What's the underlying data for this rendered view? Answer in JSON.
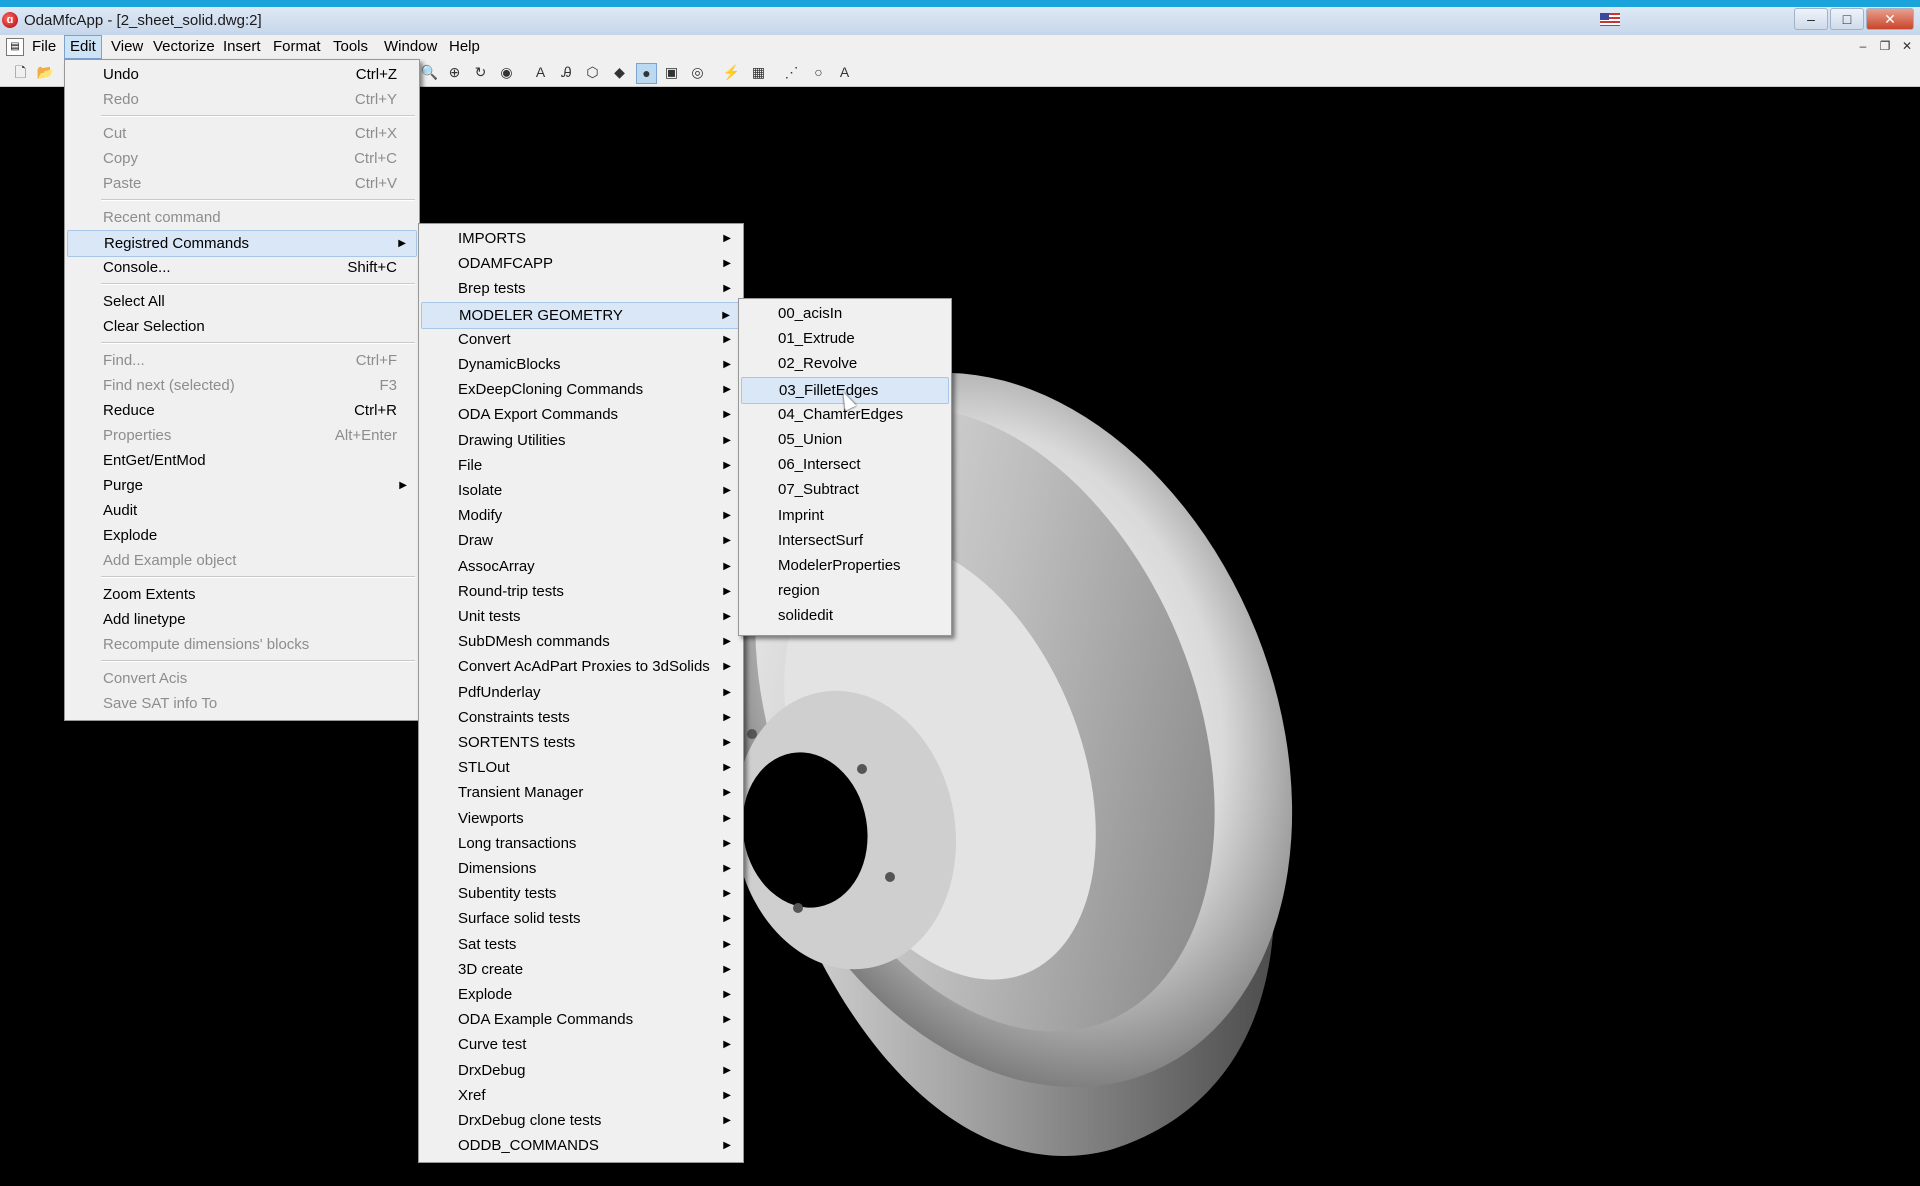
{
  "window": {
    "title": "OdaMfcApp - [2_sheet_solid.dwg:2]",
    "app_icon": "oda-app-icon",
    "controls": [
      "–",
      "□",
      "✕"
    ],
    "mdi_controls": [
      "–",
      "❐",
      "✕"
    ]
  },
  "menubar": [
    "File",
    "Edit",
    "View",
    "Vectorize",
    "Insert",
    "Format",
    "Tools",
    "Window",
    "Help"
  ],
  "edit_menu": [
    {
      "label": "Undo",
      "shortcut": "Ctrl+Z",
      "disabled": false
    },
    {
      "label": "Redo",
      "shortcut": "Ctrl+Y",
      "disabled": true
    },
    {
      "sep": true
    },
    {
      "label": "Cut",
      "shortcut": "Ctrl+X",
      "disabled": true
    },
    {
      "label": "Copy",
      "shortcut": "Ctrl+C",
      "disabled": true
    },
    {
      "label": "Paste",
      "shortcut": "Ctrl+V",
      "disabled": true
    },
    {
      "sep": true
    },
    {
      "label": "Recent command",
      "shortcut": "",
      "disabled": true
    },
    {
      "label": "Registred Commands",
      "shortcut": "",
      "submenu": true,
      "highlight": true
    },
    {
      "label": "Console...",
      "shortcut": "Shift+C",
      "disabled": false
    },
    {
      "sep": true
    },
    {
      "label": "Select All",
      "shortcut": "",
      "disabled": false
    },
    {
      "label": "Clear Selection",
      "shortcut": "",
      "disabled": false
    },
    {
      "sep": true
    },
    {
      "label": "Find...",
      "shortcut": "Ctrl+F",
      "disabled": true
    },
    {
      "label": "Find next (selected)",
      "shortcut": "F3",
      "disabled": true
    },
    {
      "label": "Reduce",
      "shortcut": "Ctrl+R",
      "disabled": false
    },
    {
      "label": "Properties",
      "shortcut": "Alt+Enter",
      "disabled": true
    },
    {
      "label": "EntGet/EntMod",
      "shortcut": "",
      "disabled": false
    },
    {
      "label": "Purge",
      "shortcut": "",
      "submenu": true
    },
    {
      "label": "Audit",
      "shortcut": "",
      "disabled": false
    },
    {
      "label": "Explode",
      "shortcut": "",
      "disabled": false
    },
    {
      "label": "Add Example object",
      "shortcut": "",
      "disabled": true
    },
    {
      "sep": true
    },
    {
      "label": "Zoom Extents",
      "shortcut": "",
      "disabled": false
    },
    {
      "label": "Add linetype",
      "shortcut": "",
      "disabled": false
    },
    {
      "label": "Recompute dimensions' blocks",
      "shortcut": "",
      "disabled": true
    },
    {
      "sep": true
    },
    {
      "label": "Convert Acis",
      "shortcut": "",
      "disabled": true
    },
    {
      "label": "Save SAT info To",
      "shortcut": "",
      "disabled": true
    }
  ],
  "registered_commands_menu": [
    "IMPORTS",
    "ODAMFCAPP",
    "Brep tests",
    "MODELER GEOMETRY",
    "Convert",
    "DynamicBlocks",
    "ExDeepCloning Commands",
    "ODA Export Commands",
    "Drawing Utilities",
    "File",
    "Isolate",
    "Modify",
    "Draw",
    "AssocArray",
    "Round-trip tests",
    "Unit tests",
    "SubDMesh commands",
    "Convert AcAdPart Proxies to 3dSolids",
    "PdfUnderlay",
    "Constraints tests",
    "SORTENTS tests",
    "STLOut",
    "Transient Manager",
    "Viewports",
    "Long transactions",
    "Dimensions",
    "Subentity tests",
    "Surface solid tests",
    "Sat tests",
    "3D create",
    "Explode",
    "ODA Example Commands",
    "Curve test",
    "DrxDebug",
    "Xref",
    "DrxDebug clone tests",
    "ODDB_COMMANDS"
  ],
  "registered_highlight": "MODELER GEOMETRY",
  "modeler_geometry_menu": [
    "00_acisIn",
    "01_Extrude",
    "02_Revolve",
    "03_FilletEdges",
    "04_ChamferEdges",
    "05_Union",
    "06_Intersect",
    "07_Subtract",
    "Imprint",
    "IntersectSurf",
    "ModelerProperties",
    "region",
    "solidedit"
  ],
  "modeler_highlight": "03_FilletEdges",
  "toolbar_icons": [
    "new-icon",
    "open-icon",
    "zoom-icon",
    "zoom-window-icon",
    "orbit-icon",
    "view-icon",
    "text-icon",
    "text-style-icon",
    "wireframe-icon",
    "shaded-icon",
    "render-icon",
    "box-icon",
    "sphere-icon",
    "lightning-icon",
    "image-icon",
    "point-icon",
    "circle-icon",
    "letter-a-icon"
  ]
}
